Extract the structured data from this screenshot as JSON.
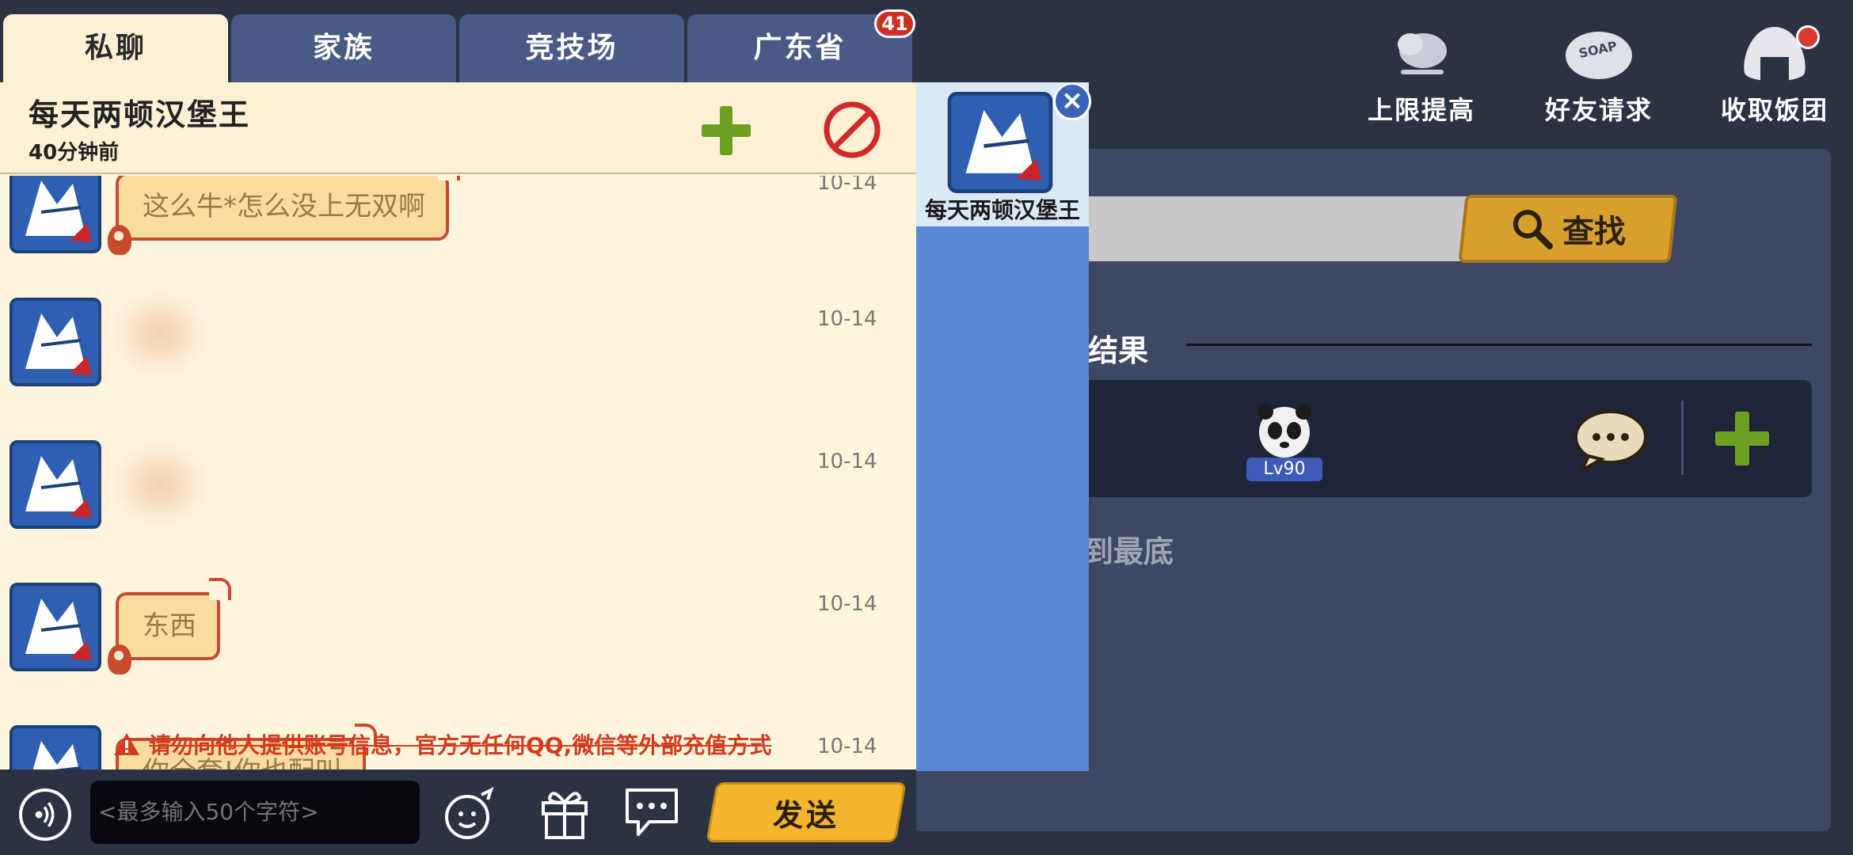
{
  "top_bar": {
    "limit_label": "上限提高",
    "friend_request_label": "好友请求",
    "collect_label": "收取饭团"
  },
  "search": {
    "button_label": "查找",
    "result_label": "结果",
    "level": "Lv90",
    "bottom_text": "到最底"
  },
  "tabs": [
    {
      "label": "私聊"
    },
    {
      "label": "家族"
    },
    {
      "label": "竞技场"
    },
    {
      "label": "广东省"
    }
  ],
  "tab_badge": "41",
  "chat": {
    "name": "每天两顿汉堡王",
    "last_seen": "40分钟前"
  },
  "messages": [
    {
      "text": "这么牛*怎么没上无双啊",
      "date": "10-14"
    },
    {
      "text": "",
      "date": "10-14"
    },
    {
      "text": "",
      "date": "10-14"
    },
    {
      "text": "东西",
      "date": "10-14"
    },
    {
      "text": "你全套!你也配叫",
      "date": "10-14"
    }
  ],
  "warning": "请勿向他人提供账号信息，官方无任何QQ,微信等外部充值方式",
  "input": {
    "placeholder": "<最多输入50个字符>",
    "send_label": "发送"
  },
  "contact": {
    "name": "每天两顿汉堡王"
  },
  "colors": {
    "background": "#2b3244",
    "chat_bg": "#fdf6dc",
    "tab": "#4a5a86",
    "send_button": "#f2b52b",
    "contact_list": "#5a86d6",
    "warning": "#d23b20"
  }
}
